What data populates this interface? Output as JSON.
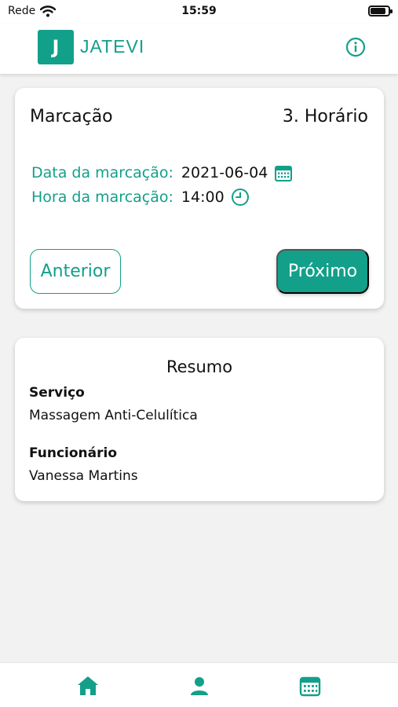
{
  "status_bar": {
    "carrier": "Rede",
    "time": "15:59",
    "battery_level": 0.85
  },
  "header": {
    "logo_letter": "J",
    "app_name": "JATEVI",
    "info_icon": "info-icon"
  },
  "booking": {
    "title": "Marcação",
    "step": "3. Horário",
    "date_label": "Data da marcação:",
    "date_value": "2021-06-04",
    "time_label": "Hora da marcação:",
    "time_value": "14:00",
    "prev_label": "Anterior",
    "next_label": "Próximo"
  },
  "summary": {
    "title": "Resumo",
    "service_label": "Serviço",
    "service_value": "Massagem Anti-Celulítica",
    "employee_label": "Funcionário",
    "employee_value": "Vanessa Martins"
  },
  "bottom_nav": {
    "items": [
      "home-icon",
      "user-icon",
      "calendar-icon"
    ]
  },
  "colors": {
    "accent": "#12a08a",
    "background": "#f2f2f2",
    "card": "#ffffff"
  }
}
